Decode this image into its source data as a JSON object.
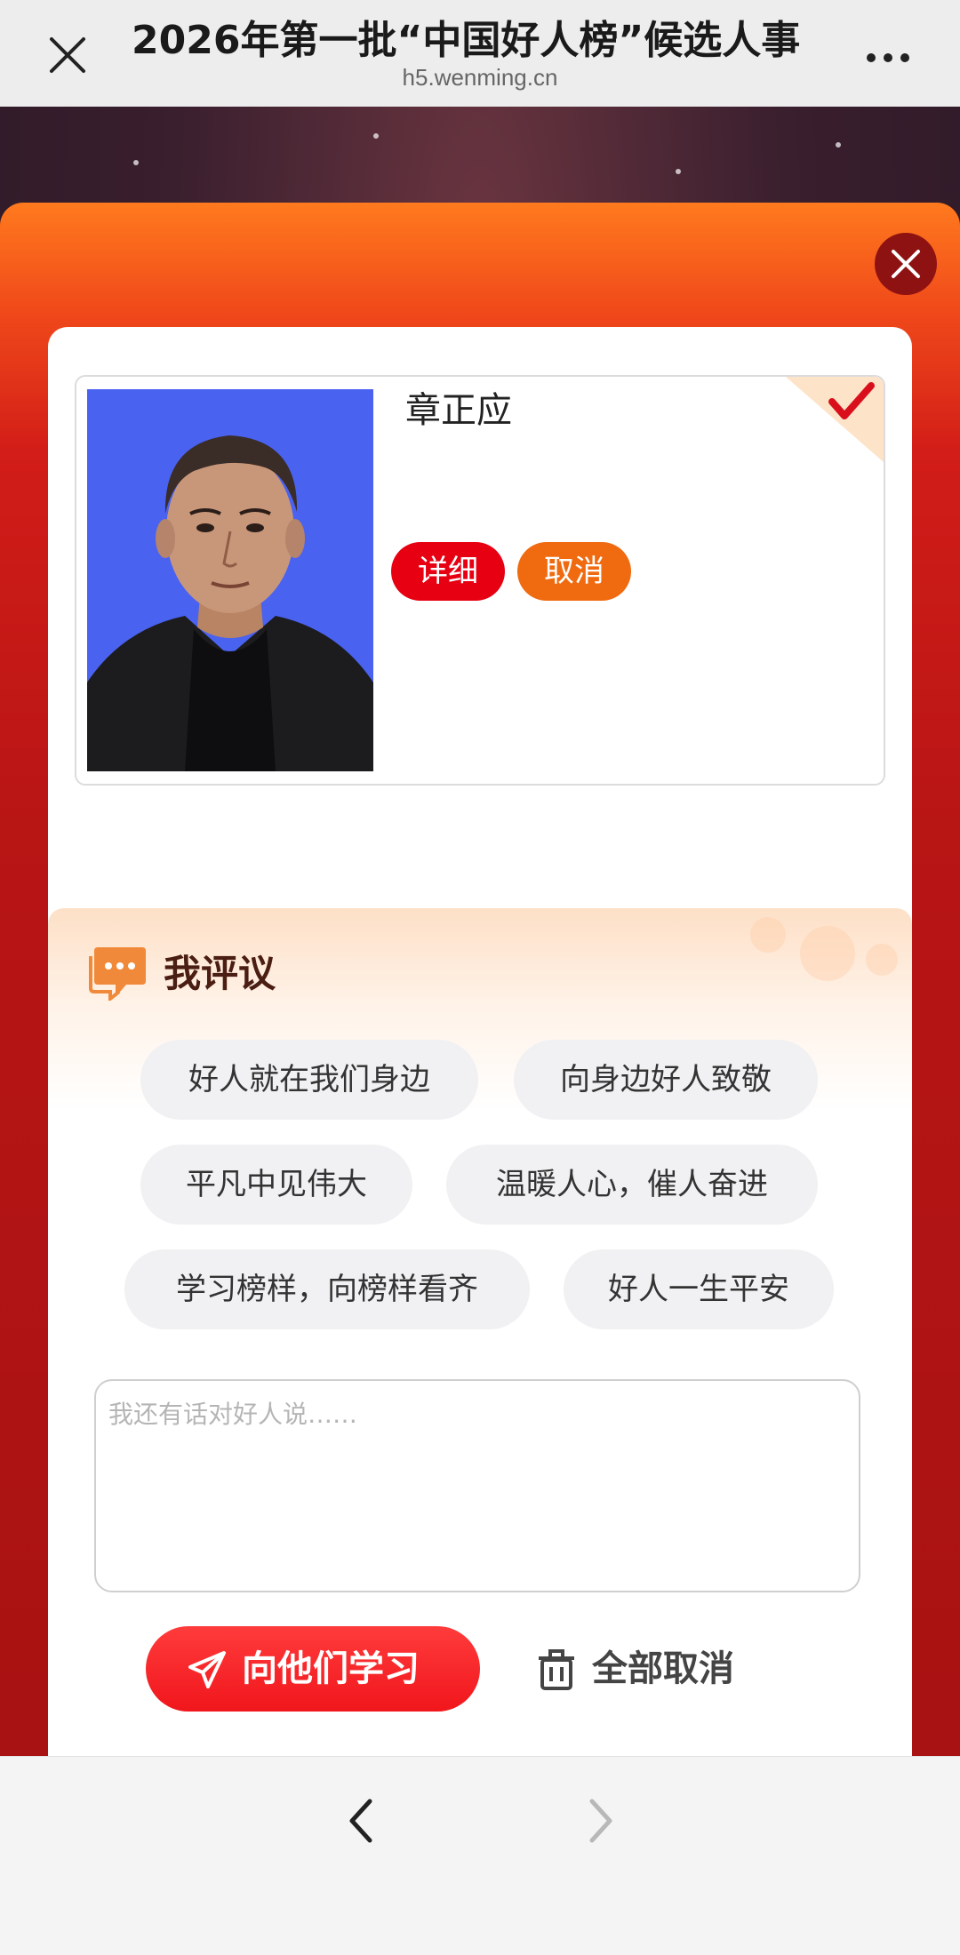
{
  "browser": {
    "page_title": "2026年第一批“中国好人榜”候选人事",
    "domain": "h5.wenming.cn",
    "close_icon": "close-icon",
    "more_icon": "more-dots-icon"
  },
  "candidate": {
    "name": "章正应",
    "detail_label": "详细",
    "cancel_label": "取消",
    "selected": true
  },
  "comment": {
    "section_title": "我评议",
    "chips": [
      "好人就在我们身边",
      "向身边好人致敬",
      "平凡中见伟大",
      "温暖人心，催人奋进",
      "学习榜样，向榜样看齐",
      "好人一生平安"
    ],
    "textarea_placeholder": "我还有话对好人说……",
    "textarea_value": "",
    "submit_label": "向他们学习",
    "cancel_all_label": "全部取消"
  },
  "colors": {
    "accent_red": "#e60012",
    "accent_orange": "#f06a0f",
    "frame_red": "#b81515"
  }
}
